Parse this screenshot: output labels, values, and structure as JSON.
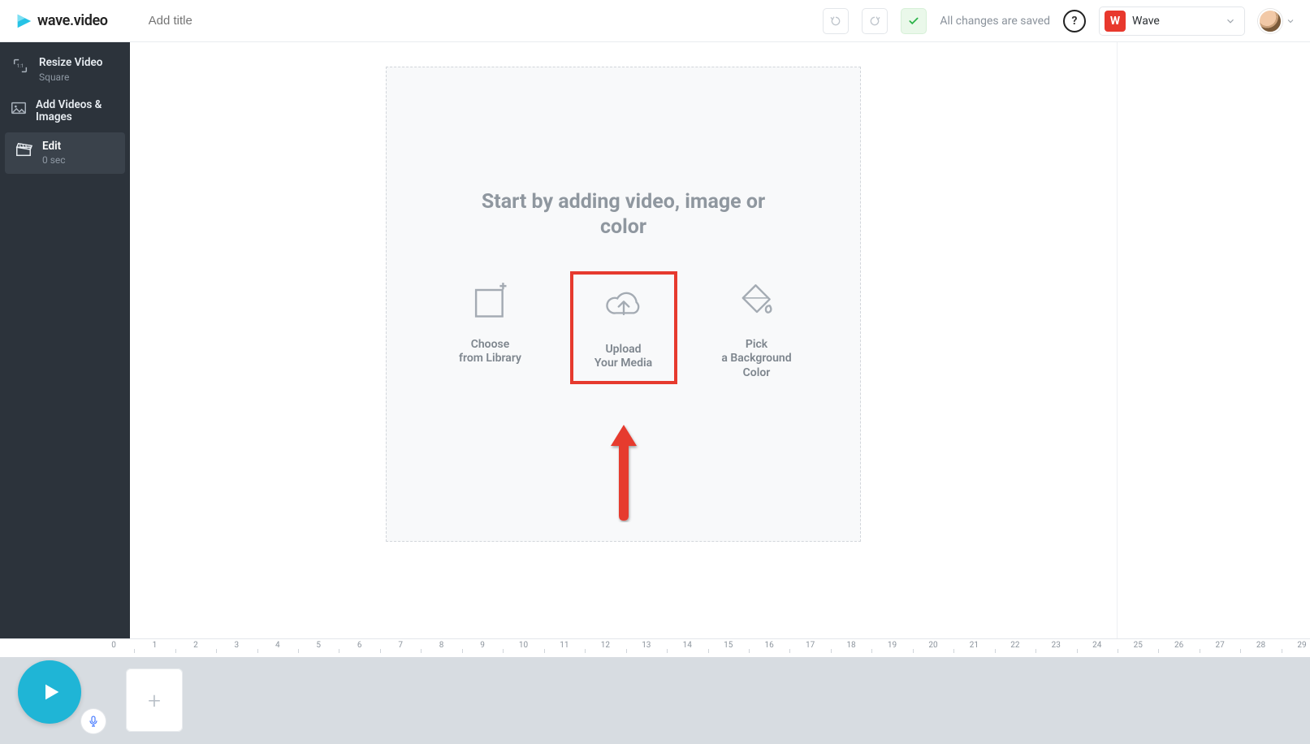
{
  "header": {
    "brand": "wave.video",
    "title_placeholder": "Add title",
    "save_status": "All changes are saved",
    "workspace_badge": "W",
    "workspace_name": "Wave"
  },
  "sidebar": {
    "items": [
      {
        "title": "Resize Video",
        "subtitle": "Square"
      },
      {
        "title": "Add Videos & Images",
        "subtitle": ""
      },
      {
        "title": "Edit",
        "subtitle": "0 sec"
      }
    ]
  },
  "canvas": {
    "heading": "Start by adding video, image or color",
    "options": [
      {
        "line1": "Choose",
        "line2": "from Library"
      },
      {
        "line1": "Upload",
        "line2": "Your Media"
      },
      {
        "line1": "Pick",
        "line2": "a Background Color"
      }
    ]
  },
  "timeline": {
    "ticks": [
      0,
      1,
      2,
      3,
      4,
      5,
      6,
      7,
      8,
      9,
      10,
      11,
      12,
      13,
      14,
      15,
      16,
      17,
      18,
      19,
      20,
      21,
      22,
      23,
      24,
      25,
      26,
      27,
      28,
      29
    ]
  }
}
